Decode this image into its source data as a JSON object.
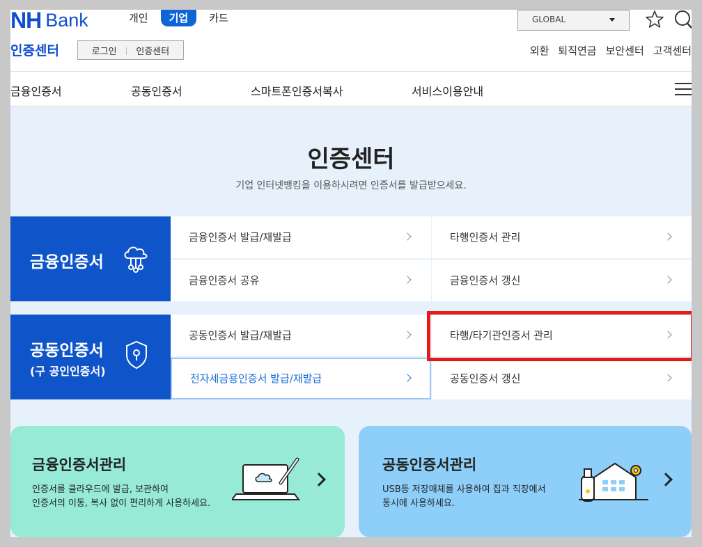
{
  "header": {
    "logo_nh": "NH",
    "logo_bank": "Bank",
    "segment_tabs": [
      {
        "label": "개인",
        "active": false
      },
      {
        "label": "기업",
        "active": true
      },
      {
        "label": "카드",
        "active": false
      }
    ],
    "global_select": "GLOBAL",
    "cert_center": "인증센터",
    "login": "로그인",
    "login_cert": "인증센터",
    "util_links": [
      "외환",
      "퇴직연금",
      "보안센터",
      "고객센터"
    ]
  },
  "gnb": [
    "금융인증서",
    "공동인증서",
    "스마트폰인증서복사",
    "서비스이용안내"
  ],
  "main": {
    "title": "인증센터",
    "subtitle": "기업 인터넷뱅킹을 이용하시려면 인증서를 발급받으세요."
  },
  "categories": [
    {
      "title": "금융인증서",
      "subtitle": "",
      "items": [
        "금융인증서 발급/재발급",
        "타행인증서 관리",
        "금융인증서 공유",
        "금융인증서 갱신"
      ]
    },
    {
      "title": "공동인증서",
      "subtitle": "(구 공인인증서)",
      "items": [
        "공동인증서 발급/재발급",
        "타행/타기관인증서 관리",
        "전자세금용인증서 발급/재발급",
        "공동인증서 갱신"
      ]
    }
  ],
  "cards": [
    {
      "title": "금융인증서관리",
      "desc_line1": "인증서를 클라우드에 발급, 보관하여",
      "desc_line2": "인증서의 이동, 복사 없이 편리하게 사용하세요.",
      "color": "#96ead6"
    },
    {
      "title": "공동인증서관리",
      "desc_line1": "USB등 저장매체를 사용하여 집과 직장에서",
      "desc_line2": "동시에 사용하세요.",
      "color": "#8ecffa"
    }
  ],
  "colors": {
    "brand": "#0f4fcf",
    "category_bg": "#0f55c9",
    "page_bg": "#e6f1fc",
    "highlight_box": "#e11a1a"
  }
}
